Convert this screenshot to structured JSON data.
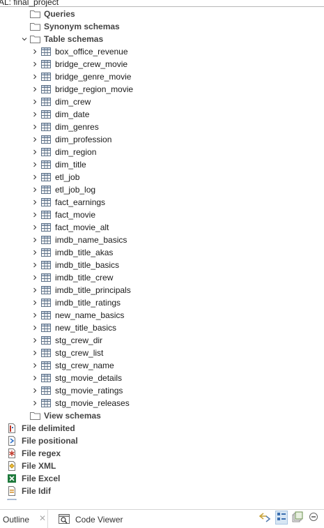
{
  "header": {
    "title": "AL: final_project"
  },
  "tree": {
    "folders_top": [
      {
        "label": "Queries",
        "expanded": false
      },
      {
        "label": "Synonym schemas",
        "expanded": false
      },
      {
        "label": "Table schemas",
        "expanded": true
      }
    ],
    "tables": [
      "box_office_revenue",
      "bridge_crew_movie",
      "bridge_genre_movie",
      "bridge_region_movie",
      "dim_crew",
      "dim_date",
      "dim_genres",
      "dim_profession",
      "dim_region",
      "dim_title",
      "etl_job",
      "etl_job_log",
      "fact_earnings",
      "fact_movie",
      "fact_movie_alt",
      "imdb_name_basics",
      "imdb_title_akas",
      "imdb_title_basics",
      "imdb_title_crew",
      "imdb_title_principals",
      "imdb_title_ratings",
      "new_name_basics",
      "new_title_basics",
      "stg_crew_dir",
      "stg_crew_list",
      "stg_crew_name",
      "stg_movie_details",
      "stg_movie_ratings",
      "stg_movie_releases"
    ],
    "folder_bottom": {
      "label": "View schemas",
      "expanded": false
    },
    "files": [
      {
        "label": "File delimited",
        "icon": "file-delimited-icon"
      },
      {
        "label": "File positional",
        "icon": "file-positional-icon"
      },
      {
        "label": "File regex",
        "icon": "file-regex-icon"
      },
      {
        "label": "File XML",
        "icon": "file-xml-icon"
      },
      {
        "label": "File Excel",
        "icon": "file-excel-icon"
      },
      {
        "label": "File Idif",
        "icon": "file-ldif-icon"
      }
    ]
  },
  "bottom_tabs": {
    "outline": "Outline",
    "outline_close": "✕",
    "code_viewer": "Code Viewer"
  },
  "colors": {
    "folder": "#7a7a7a",
    "table_grid": "#5b6f86",
    "separator": "#b7b7b7",
    "active_toggle": "#d7e6f4"
  }
}
